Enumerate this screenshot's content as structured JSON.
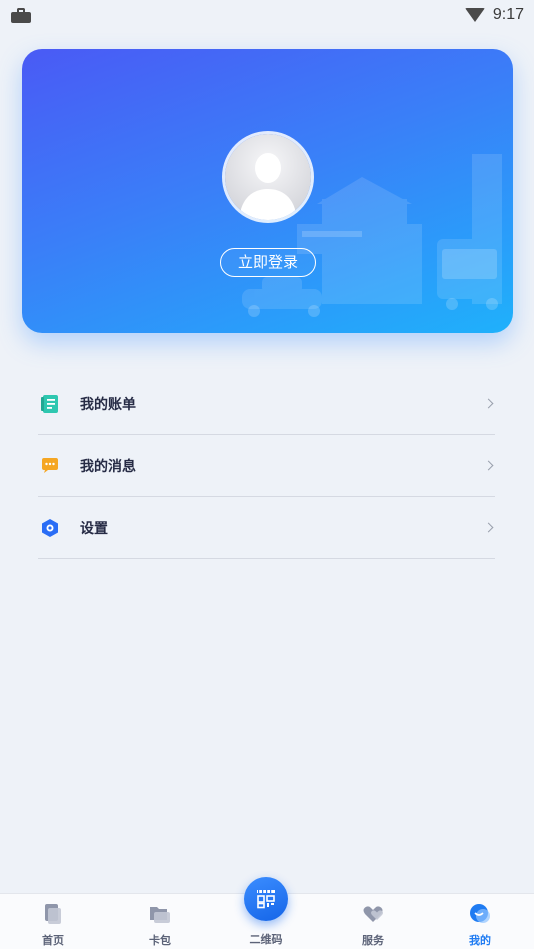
{
  "status_bar": {
    "time": "9:17"
  },
  "profile": {
    "login_label": "立即登录"
  },
  "menu": {
    "items": [
      {
        "label": "我的账单",
        "icon": "bill-icon"
      },
      {
        "label": "我的消息",
        "icon": "message-icon"
      },
      {
        "label": "设置",
        "icon": "settings-icon"
      }
    ]
  },
  "tab_bar": {
    "tabs": [
      {
        "label": "首页",
        "icon": "home-icon"
      },
      {
        "label": "卡包",
        "icon": "wallet-icon"
      },
      {
        "label": "二维码",
        "icon": "qr-code-icon"
      },
      {
        "label": "服务",
        "icon": "heart-service-icon"
      },
      {
        "label": "我的",
        "icon": "profile-icon",
        "active": true
      }
    ]
  },
  "colors": {
    "card_gradient_start": "#4a5af5",
    "card_gradient_end": "#1fb1fb",
    "active_tab": "#1f7bf2",
    "bill_icon": "#2ec7b0",
    "message_icon": "#f5a623",
    "settings_icon": "#2a6df5"
  }
}
